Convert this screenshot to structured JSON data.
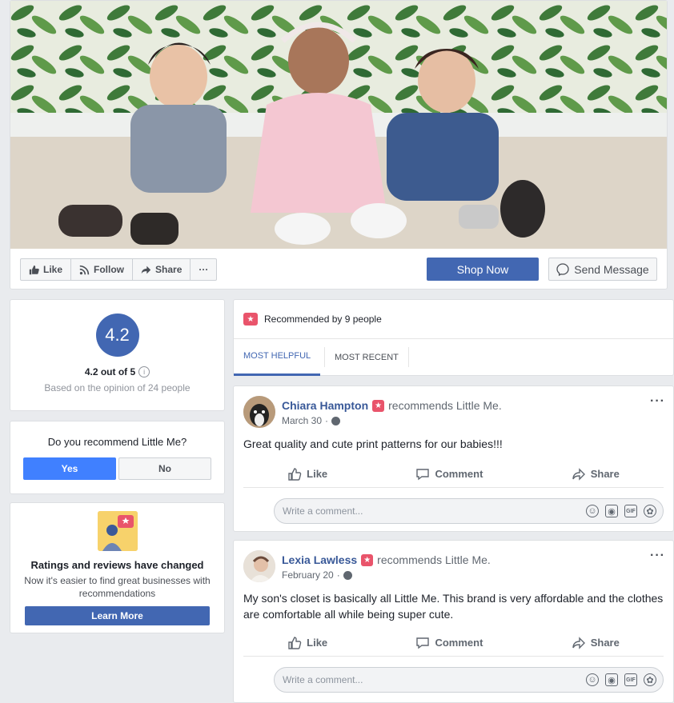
{
  "page_actions": {
    "like": "Like",
    "follow": "Follow",
    "share": "Share",
    "more": "···",
    "shop_now": "Shop Now",
    "send_message": "Send Message"
  },
  "rating": {
    "score": "4.2",
    "out_of": "4.2 out of 5",
    "info": "i",
    "basis": "Based on the opinion of 24 people"
  },
  "recommend_question": {
    "title": "Do you recommend Little Me?",
    "yes": "Yes",
    "no": "No"
  },
  "ratings_change": {
    "title": "Ratings and reviews have changed",
    "description": "Now it's easier to find great businesses with recommendations",
    "button": "Learn More"
  },
  "recommendations": {
    "summary": "Recommended by 9 people",
    "tabs": [
      "MOST HELPFUL",
      "MOST RECENT"
    ]
  },
  "reviews": [
    {
      "name": "Chiara Hampton",
      "action": "recommends Little Me.",
      "date": "March 30",
      "text": "Great quality and cute print patterns for our babies!!!"
    },
    {
      "name": "Lexia Lawless",
      "action": "recommends Little Me.",
      "date": "February 20",
      "text": "My son's closet is basically all Little Me. This brand is very affordable and the clothes are comfortable all while being super cute."
    }
  ],
  "review_actions": {
    "like": "Like",
    "comment": "Comment",
    "share": "Share",
    "comment_placeholder": "Write a comment...",
    "more": "···",
    "gif": "GIF"
  },
  "colors": {
    "brand_blue": "#4267b2",
    "yes_blue": "#4080ff",
    "recommend_red": "#e9546b"
  }
}
